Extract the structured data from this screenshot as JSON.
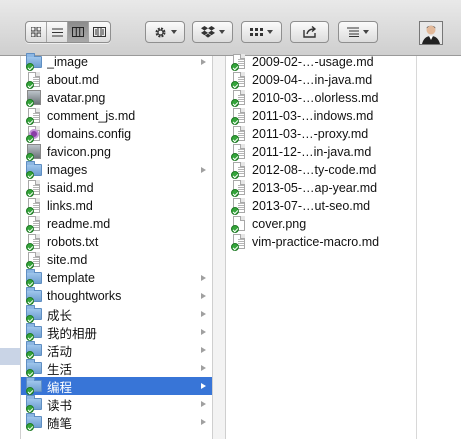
{
  "toolbar": {
    "view_buttons": [
      "icon-view-icon",
      "list-view-icon",
      "column-view-icon",
      "coverflow-view-icon"
    ],
    "active_view": 2,
    "action_icon": "gear-icon",
    "dropbox_icon": "dropbox-icon",
    "arrange_icon": "arrange-icon",
    "share_icon": "share-icon",
    "sort_icon": "sort-list-icon"
  },
  "column2": {
    "items": [
      {
        "name": "_image",
        "kind": "folder",
        "chevron": true
      },
      {
        "name": "about.md",
        "kind": "doc"
      },
      {
        "name": "avatar.png",
        "kind": "img"
      },
      {
        "name": "comment_js.md",
        "kind": "doc"
      },
      {
        "name": "domains.config",
        "kind": "config"
      },
      {
        "name": "favicon.png",
        "kind": "img"
      },
      {
        "name": "images",
        "kind": "folder",
        "chevron": true
      },
      {
        "name": "isaid.md",
        "kind": "doc"
      },
      {
        "name": "links.md",
        "kind": "doc"
      },
      {
        "name": "readme.md",
        "kind": "doc"
      },
      {
        "name": "robots.txt",
        "kind": "doc"
      },
      {
        "name": "site.md",
        "kind": "doc"
      },
      {
        "name": "template",
        "kind": "folder",
        "chevron": true
      },
      {
        "name": "thoughtworks",
        "kind": "folder",
        "chevron": true
      },
      {
        "name": "成长",
        "kind": "folder",
        "chevron": true
      },
      {
        "name": "我的相册",
        "kind": "folder",
        "chevron": true
      },
      {
        "name": "活动",
        "kind": "folder",
        "chevron": true
      },
      {
        "name": "生活",
        "kind": "folder",
        "chevron": true
      },
      {
        "name": "编程",
        "kind": "folder",
        "chevron": true,
        "selected": true
      },
      {
        "name": "读书",
        "kind": "folder",
        "chevron": true
      },
      {
        "name": "随笔",
        "kind": "folder",
        "chevron": true
      }
    ]
  },
  "column3": {
    "items": [
      {
        "name": "2009-02-…-usage.md",
        "kind": "doc"
      },
      {
        "name": "2009-04-…in-java.md",
        "kind": "doc"
      },
      {
        "name": "2010-03-…olorless.md",
        "kind": "doc"
      },
      {
        "name": "2011-03-…indows.md",
        "kind": "doc"
      },
      {
        "name": "2011-03-…-proxy.md",
        "kind": "doc"
      },
      {
        "name": "2011-12-…in-java.md",
        "kind": "doc"
      },
      {
        "name": "2012-08-…ty-code.md",
        "kind": "doc"
      },
      {
        "name": "2013-05-…ap-year.md",
        "kind": "doc"
      },
      {
        "name": "2013-07-…ut-seo.md",
        "kind": "doc"
      },
      {
        "name": "cover.png",
        "kind": "png"
      },
      {
        "name": "vim-practice-macro.md",
        "kind": "doc"
      }
    ]
  },
  "colors": {
    "selection": "#3875d7",
    "folder": "#8db7e3",
    "sync_check": "#34a53a"
  }
}
